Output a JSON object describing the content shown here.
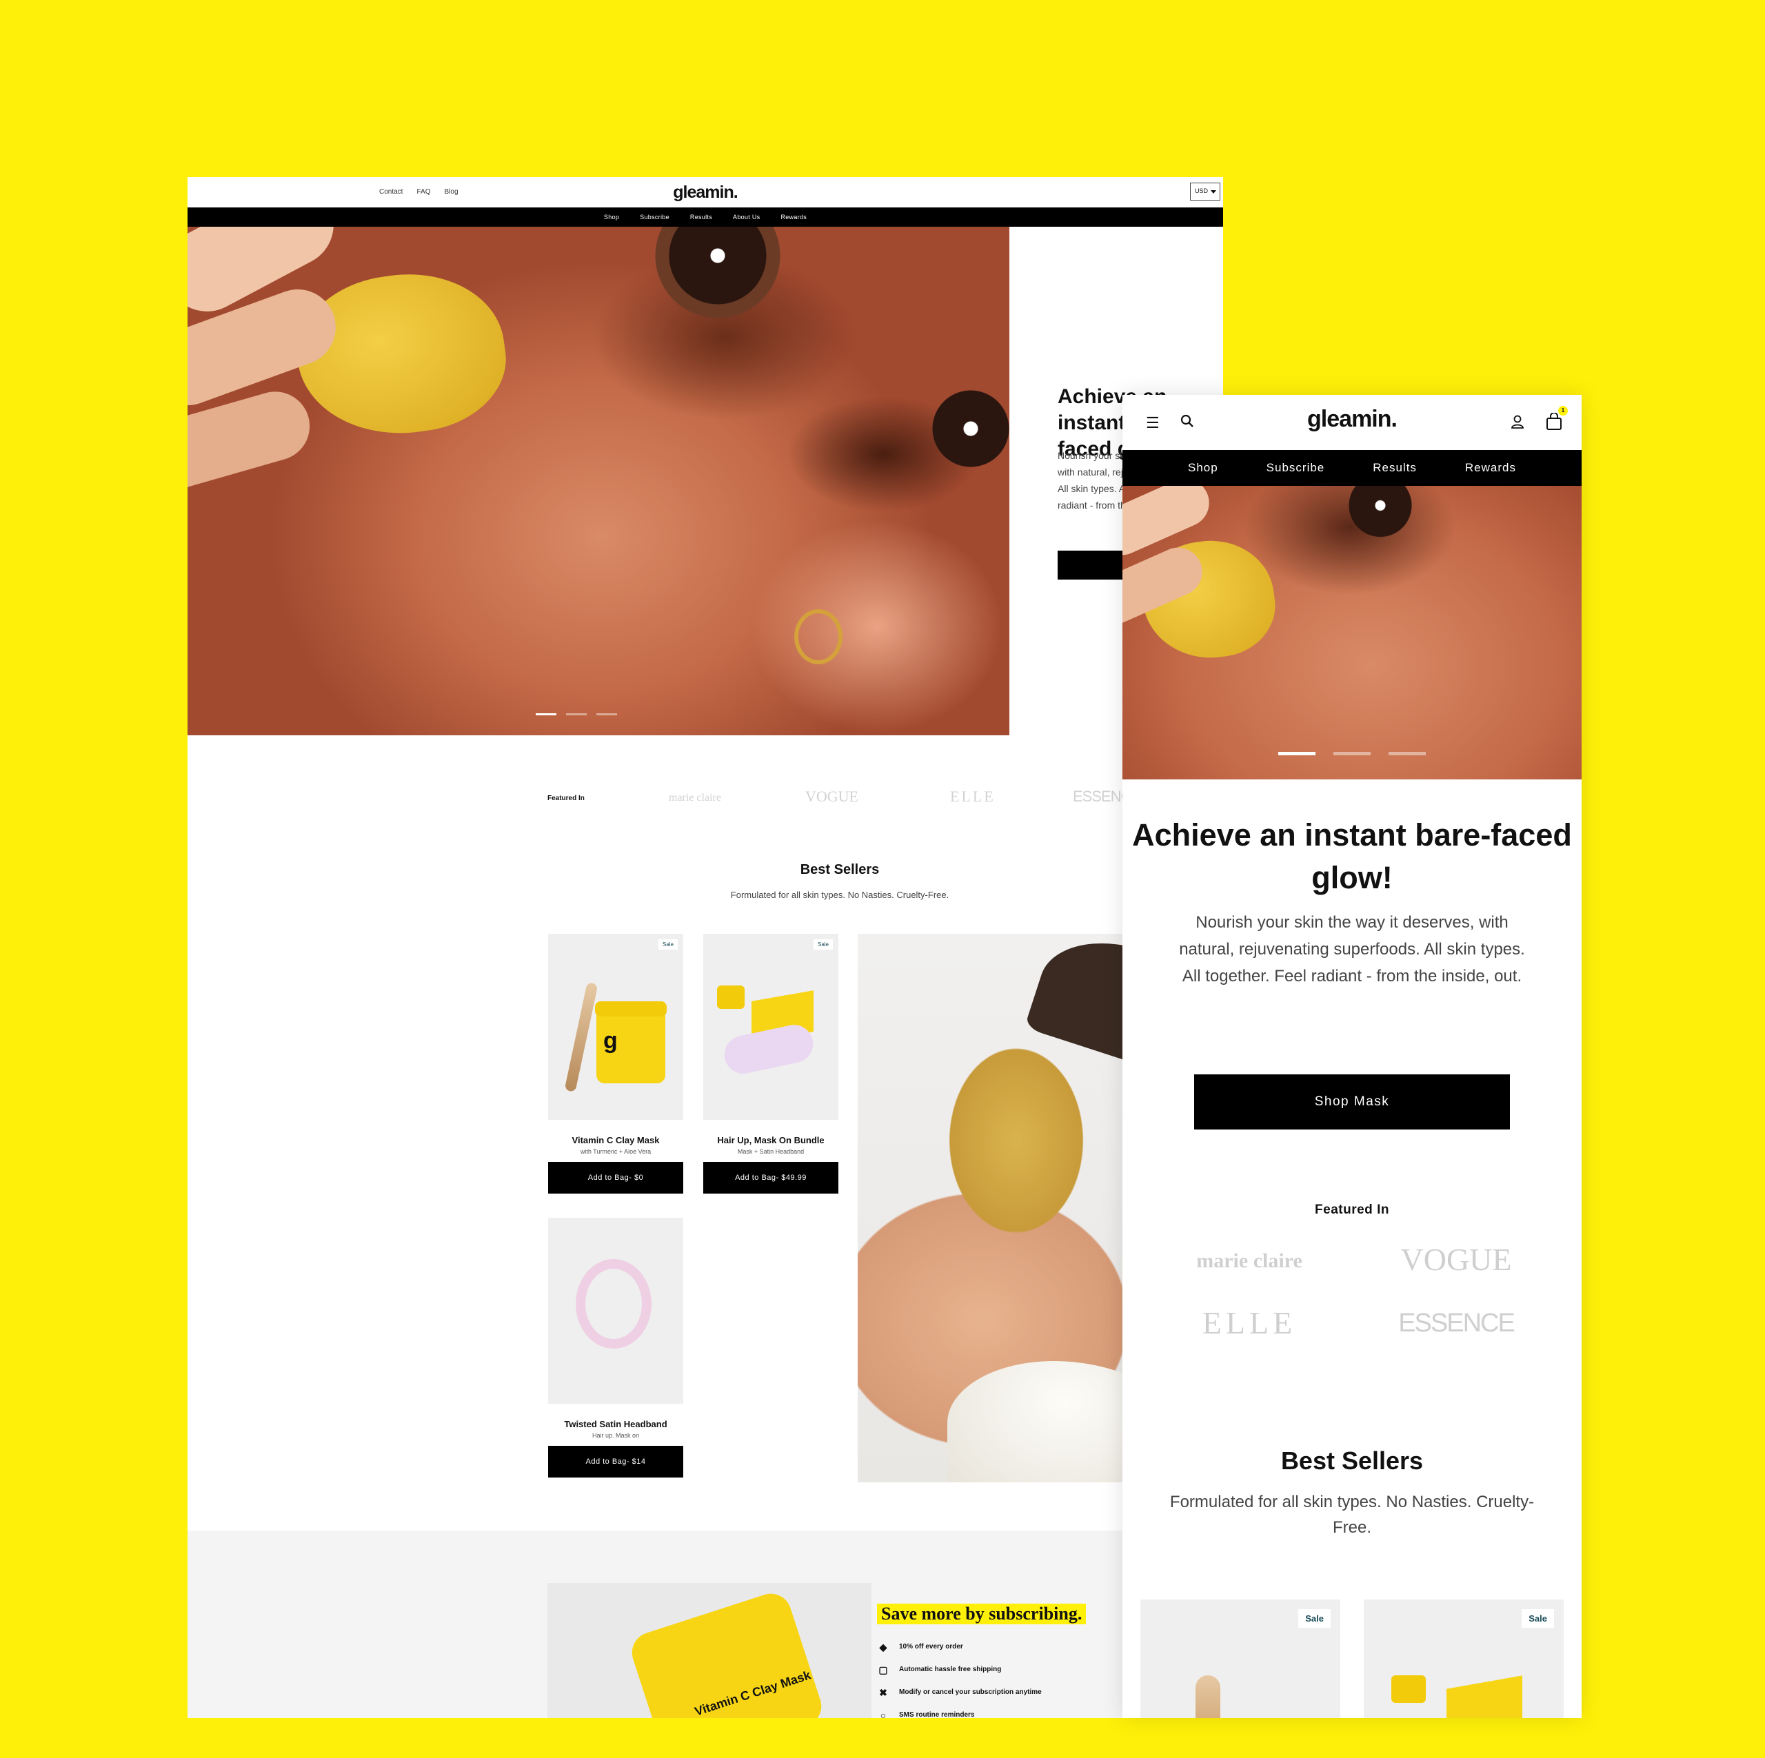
{
  "brand": {
    "logo": "gleamin.",
    "accent": "#FFF009",
    "dark": "#000000"
  },
  "desktop": {
    "top_links": [
      "Contact",
      "FAQ",
      "Blog"
    ],
    "currency": "USD",
    "nav": [
      "Shop",
      "Subscribe",
      "Results",
      "About Us",
      "Rewards"
    ],
    "hero": {
      "heading": "Achieve an instant bare-faced glow!",
      "body": "Nourish your skin the way it deserves, with natural, rejuvenating superfoods. All skin types. All together. Feel radiant - from the inside, out."
    },
    "featured": {
      "label": "Featured In",
      "publications": [
        "marie claire",
        "VOGUE",
        "ELLE",
        "ESSENCE"
      ]
    },
    "best_sellers": {
      "title": "Best Sellers",
      "subtitle": "Formulated for all skin types. No Nasties. Cruelty-Free.",
      "products": [
        {
          "badge": "Sale",
          "name": "Vitamin C Clay Mask",
          "sub": "with Turmeric + Aloe Vera",
          "button": "Add to Bag- $0"
        },
        {
          "badge": "Sale",
          "name": "Hair Up, Mask On Bundle",
          "sub": "Mask + Satin Headband",
          "button": "Add to Bag- $49.99"
        },
        {
          "badge": "",
          "name": "Twisted Satin Headband",
          "sub": "Hair up. Mask on",
          "button": "Add to Bag- $14"
        }
      ]
    },
    "subscribe": {
      "title": "Save more by subscribing.",
      "jar_label": "Vitamin C Clay Mask",
      "benefits": [
        "10% off every order",
        "Automatic hassle free shipping",
        "Modify or cancel your subscription anytime",
        "SMS routine reminders"
      ]
    }
  },
  "mobile": {
    "logo": "gleamin.",
    "bag_count": "1",
    "nav": [
      "Shop",
      "Subscribe",
      "Results",
      "Rewards"
    ],
    "hero": {
      "heading": "Achieve an instant bare-faced glow!",
      "body": "Nourish your skin the way it deserves, with natural, rejuvenating superfoods. All skin types. All together. Feel radiant - from the inside, out.",
      "cta": "Shop Mask"
    },
    "featured": {
      "label": "Featured In",
      "publications": [
        "marie claire",
        "VOGUE",
        "ELLE",
        "ESSENCE"
      ]
    },
    "best_sellers": {
      "title": "Best Sellers",
      "subtitle": "Formulated for all skin types. No Nasties. Cruelty-Free.",
      "badges": [
        "Sale",
        "Sale"
      ]
    }
  }
}
